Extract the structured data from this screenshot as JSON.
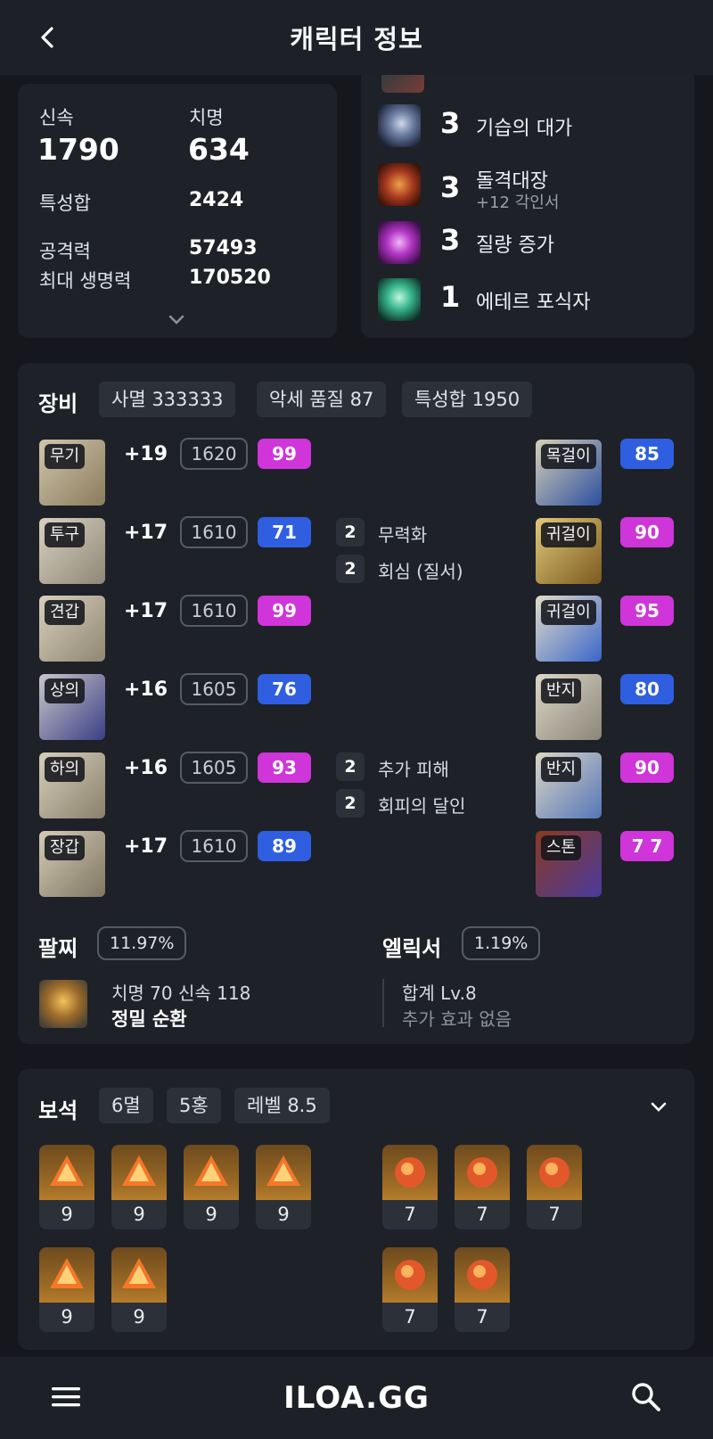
{
  "header": {
    "title": "캐릭터 정보"
  },
  "stats": {
    "primary": [
      {
        "label": "신속",
        "value": "1790"
      },
      {
        "label": "치명",
        "value": "634"
      }
    ],
    "rows": [
      {
        "label": "특성합",
        "value": "2424"
      },
      {
        "label": "공격력",
        "value": "57493"
      },
      {
        "label": "최대 생명력",
        "value": "170520"
      }
    ]
  },
  "engravings": [
    {
      "level": "3",
      "name": "기습의 대가",
      "sub": ""
    },
    {
      "level": "3",
      "name": "돌격대장",
      "sub": "+12 각인서"
    },
    {
      "level": "3",
      "name": "질량 증가",
      "sub": ""
    },
    {
      "level": "1",
      "name": "에테르 포식자",
      "sub": ""
    }
  ],
  "equipment": {
    "title": "장비",
    "chips": [
      "사멸 333333",
      "악세 품질 87",
      "특성합 1950"
    ],
    "armor": [
      {
        "slot": "무기",
        "enhance": "+19",
        "item_level": "1620",
        "quality": "99",
        "quality_color": "#cf35d9"
      },
      {
        "slot": "투구",
        "enhance": "+17",
        "item_level": "1610",
        "quality": "71",
        "quality_color": "#2f5fe0"
      },
      {
        "slot": "견갑",
        "enhance": "+17",
        "item_level": "1610",
        "quality": "99",
        "quality_color": "#cf35d9"
      },
      {
        "slot": "상의",
        "enhance": "+16",
        "item_level": "1605",
        "quality": "76",
        "quality_color": "#2f5fe0"
      },
      {
        "slot": "하의",
        "enhance": "+16",
        "item_level": "1605",
        "quality": "93",
        "quality_color": "#cf35d9"
      },
      {
        "slot": "장갑",
        "enhance": "+17",
        "item_level": "1610",
        "quality": "89",
        "quality_color": "#2f5fe0"
      }
    ],
    "stone_effects": [
      {
        "count": "2",
        "name": "무력화"
      },
      {
        "count": "2",
        "name": "회심 (질서)"
      },
      {
        "count": "2",
        "name": "추가 피해"
      },
      {
        "count": "2",
        "name": "회피의 달인"
      }
    ],
    "accessories": [
      {
        "slot": "목걸이",
        "quality": "85",
        "quality_color": "#2f5fe0"
      },
      {
        "slot": "귀걸이",
        "quality": "90",
        "quality_color": "#cf35d9"
      },
      {
        "slot": "귀걸이",
        "quality": "95",
        "quality_color": "#cf35d9"
      },
      {
        "slot": "반지",
        "quality": "80",
        "quality_color": "#2f5fe0"
      },
      {
        "slot": "반지",
        "quality": "90",
        "quality_color": "#cf35d9"
      },
      {
        "slot": "스톤",
        "quality": "7 7",
        "quality_color": "#cf35d9"
      }
    ],
    "bracelet": {
      "title": "팔찌",
      "pct": "11.97%",
      "stats": "치명 70  신속 118",
      "effect": "정밀  순환"
    },
    "elixir": {
      "title": "엘릭서",
      "pct": "1.19%",
      "level": "합계 Lv.8",
      "effect": "추가 효과 없음"
    }
  },
  "gems": {
    "title": "보석",
    "chips": [
      "6멸",
      "5홍",
      "레벨 8.5"
    ],
    "left": [
      "9",
      "9",
      "9",
      "9",
      "9",
      "9"
    ],
    "right": [
      "7",
      "7",
      "7",
      "7",
      "7"
    ]
  },
  "bottom": {
    "logo": "ILOA.GG"
  },
  "icons": {
    "back": "chevron-left-icon",
    "expand": "chevron-down-icon",
    "menu": "hamburger-menu-icon",
    "search": "search-icon"
  }
}
